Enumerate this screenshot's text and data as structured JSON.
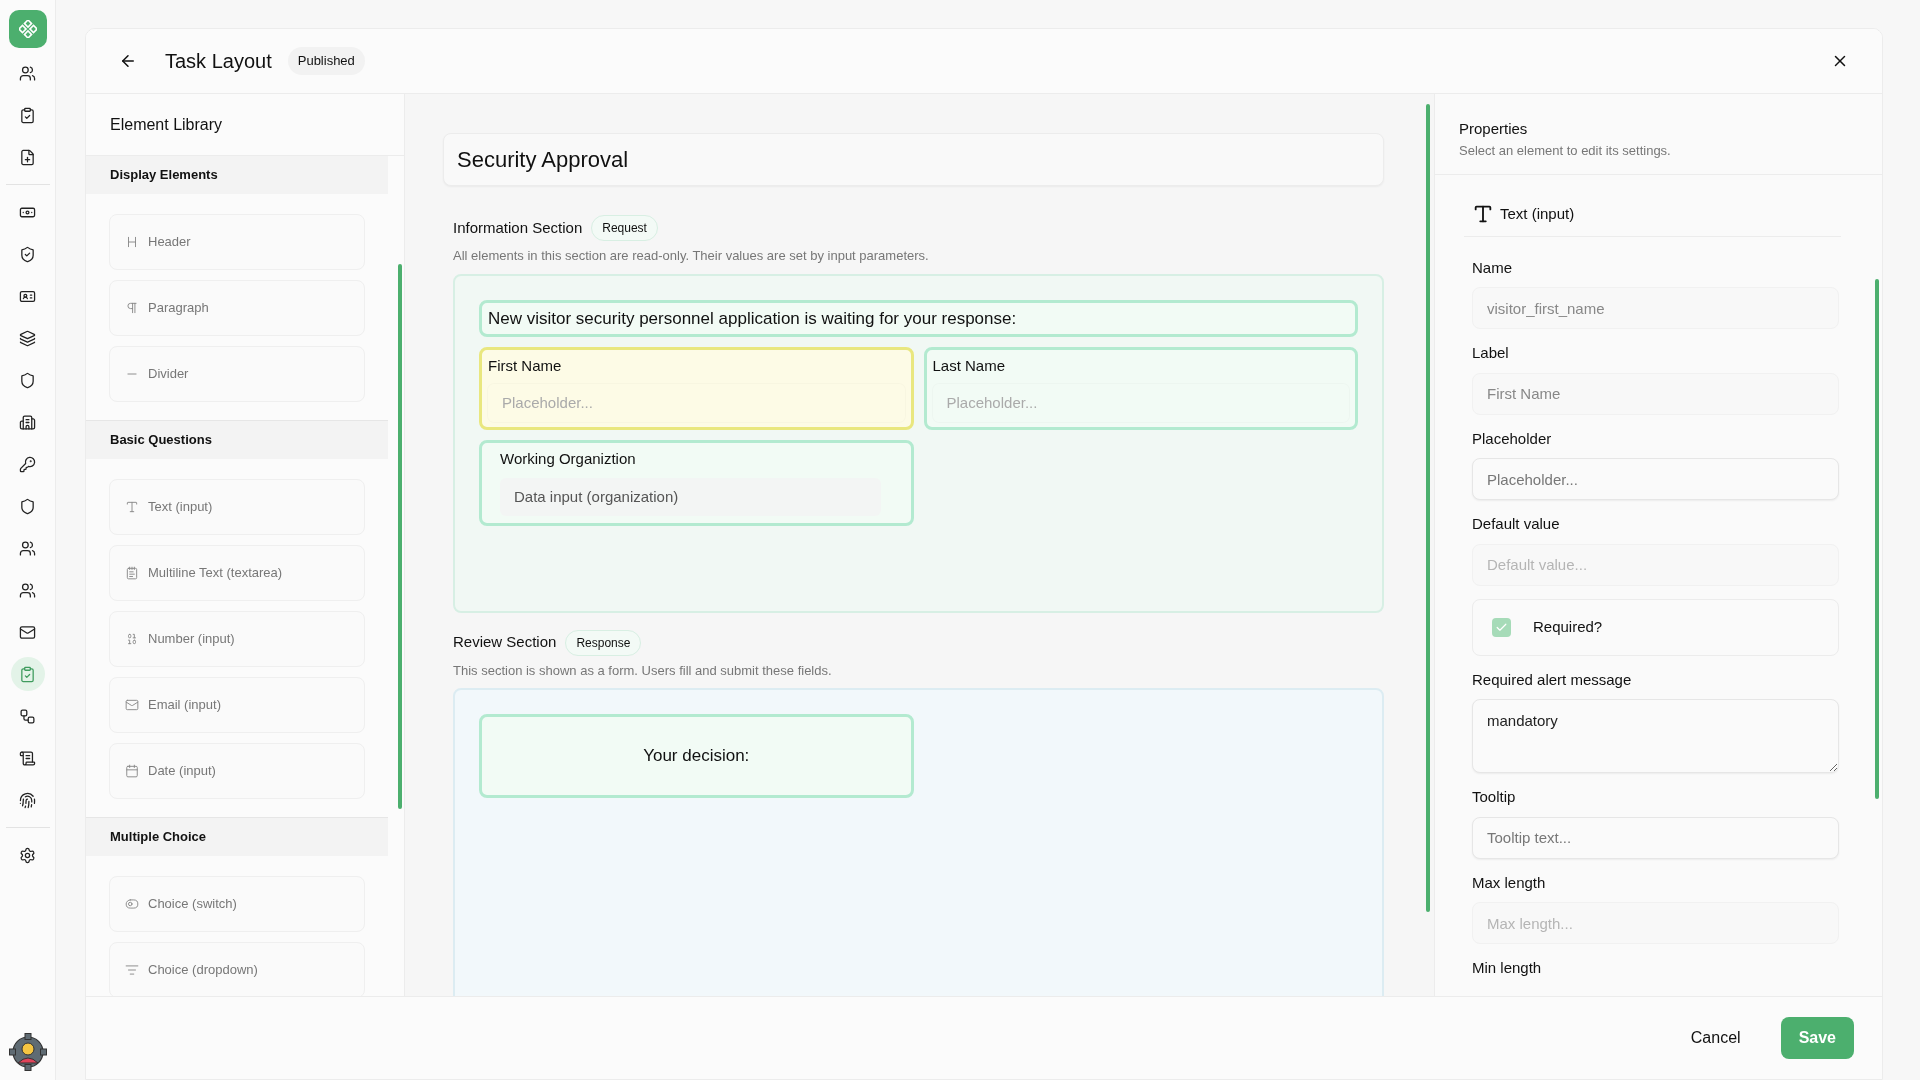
{
  "rail": {
    "groups": [
      {
        "items": [
          {
            "selected": false
          },
          {
            "selected": false
          },
          {
            "selected": false
          }
        ]
      },
      {
        "items": [
          {
            "selected": false
          },
          {
            "selected": false
          },
          {
            "selected": false
          },
          {
            "selected": false
          },
          {
            "selected": false
          },
          {
            "selected": false
          },
          {
            "selected": false
          },
          {
            "selected": false
          },
          {
            "selected": false
          },
          {
            "selected": false
          },
          {
            "selected": false
          },
          {
            "selected": true
          },
          {
            "selected": false
          },
          {
            "selected": false
          },
          {
            "selected": false
          }
        ]
      },
      {
        "items": [
          {
            "selected": false
          }
        ]
      }
    ]
  },
  "header": {
    "title": "Task Layout",
    "status": "Published"
  },
  "library": {
    "title": "Element Library",
    "sections": [
      {
        "title": "Display Elements",
        "items": [
          "Header",
          "Paragraph",
          "Divider"
        ]
      },
      {
        "title": "Basic Questions",
        "items": [
          "Text (input)",
          "Multiline Text (textarea)",
          "Number (input)",
          "Email (input)",
          "Date (input)"
        ]
      },
      {
        "title": "Multiple Choice",
        "items": [
          "Choice (switch)",
          "Choice (dropdown)"
        ]
      }
    ]
  },
  "form": {
    "title": "Security Approval",
    "sections": [
      {
        "title": "Information Section",
        "badge": "Request",
        "description": "All elements in this section are read-only. Their values are set by input parameters.",
        "kind": "request",
        "elements": [
          {
            "kind": "header",
            "text": "New visitor security personnel application is waiting for your response:",
            "selected": false
          },
          {
            "kind": "text_input",
            "label": "First Name",
            "placeholder": "Placeholder...",
            "selected": true
          },
          {
            "kind": "text_input",
            "label": "Last Name",
            "placeholder": "Placeholder...",
            "selected": false
          },
          {
            "kind": "data_input",
            "label": "Working Organiztion",
            "value": "Data input (organization)",
            "selected": false
          }
        ]
      },
      {
        "title": "Review Section",
        "badge": "Response",
        "description": "This section is shown as a form. Users fill and submit these fields.",
        "kind": "response",
        "elements": [
          {
            "kind": "decision",
            "text": "Your decision:",
            "selected": false
          }
        ]
      }
    ]
  },
  "properties": {
    "title": "Properties",
    "subtitle": "Select an element to edit its settings.",
    "element_type": "Text (input)",
    "fields": [
      {
        "kind": "input",
        "label": "Name",
        "value": "visitor_first_name",
        "disabled": true
      },
      {
        "kind": "input",
        "label": "Label",
        "value": "First Name",
        "disabled": true
      },
      {
        "kind": "input",
        "label": "Placeholder",
        "placeholder": "Placeholder...",
        "disabled": false
      },
      {
        "kind": "input",
        "label": "Default value",
        "placeholder": "Default value...",
        "disabled": true
      },
      {
        "kind": "checkbox",
        "label": "Required?",
        "checked": true,
        "disabled": true
      },
      {
        "kind": "textarea",
        "label": "Required alert message",
        "value": "mandatory",
        "disabled": false
      },
      {
        "kind": "input",
        "label": "Tooltip",
        "placeholder": "Tooltip text...",
        "disabled": false
      },
      {
        "kind": "input",
        "label": "Max length",
        "placeholder": "Max length...",
        "disabled": true
      },
      {
        "kind": "label",
        "label": "Min length"
      }
    ]
  },
  "footer": {
    "cancel": "Cancel",
    "save": "Save"
  }
}
